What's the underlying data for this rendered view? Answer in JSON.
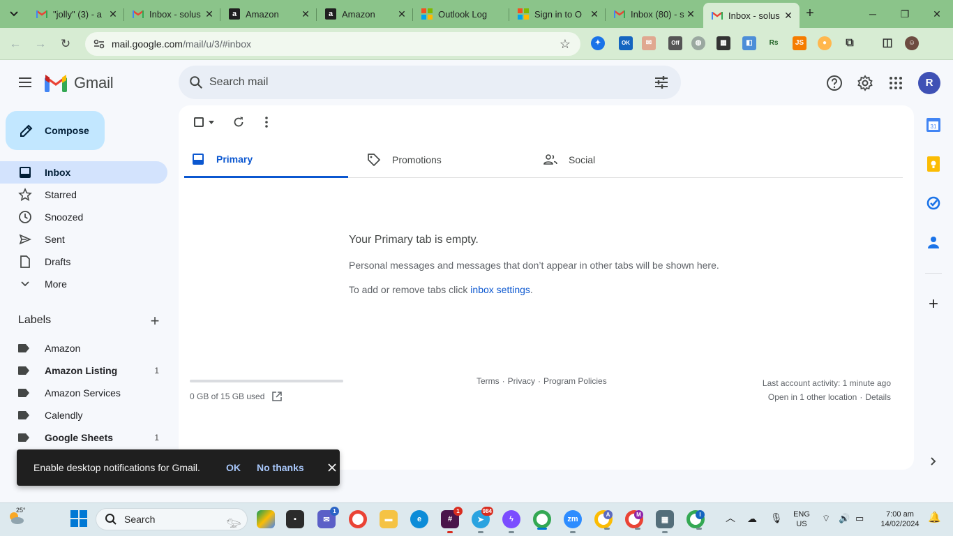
{
  "browser": {
    "tabs": [
      {
        "label": "\"jolly\" (3) - a",
        "favicon": "gmail-icon"
      },
      {
        "label": "Inbox - solus",
        "favicon": "gmail-icon"
      },
      {
        "label": "Amazon",
        "favicon": "amazon-icon"
      },
      {
        "label": "Amazon",
        "favicon": "amazon-icon"
      },
      {
        "label": "Outlook Log",
        "favicon": "microsoft-icon"
      },
      {
        "label": "Sign in to O",
        "favicon": "microsoft-icon"
      },
      {
        "label": "Inbox (80) - s",
        "favicon": "gmail-icon"
      },
      {
        "label": "Inbox - solus",
        "favicon": "gmail-icon"
      }
    ],
    "url_host": "mail.google.com",
    "url_path": "/mail/u/3/#inbox",
    "extension_badge_ok": "OK",
    "extension_badge_off": "Off"
  },
  "gmail": {
    "wordmark": "Gmail",
    "search_placeholder": "Search mail",
    "avatar_letter": "R",
    "compose_label": "Compose",
    "nav": [
      {
        "label": "Inbox",
        "icon": "inbox-icon"
      },
      {
        "label": "Starred",
        "icon": "star-icon"
      },
      {
        "label": "Snoozed",
        "icon": "clock-icon"
      },
      {
        "label": "Sent",
        "icon": "send-icon"
      },
      {
        "label": "Drafts",
        "icon": "draft-icon"
      },
      {
        "label": "More",
        "icon": "chevron-down-icon"
      }
    ],
    "labels_title": "Labels",
    "labels": [
      {
        "label": "Amazon",
        "count": ""
      },
      {
        "label": "Amazon Listing",
        "count": "1"
      },
      {
        "label": "Amazon Services",
        "count": ""
      },
      {
        "label": "Calendly",
        "count": ""
      },
      {
        "label": "Google Sheets",
        "count": "1"
      }
    ],
    "tabs": [
      {
        "label": "Primary",
        "icon": "inbox-icon"
      },
      {
        "label": "Promotions",
        "icon": "tag-icon"
      },
      {
        "label": "Social",
        "icon": "people-icon"
      }
    ],
    "empty": {
      "title": "Your Primary tab is empty.",
      "description": "Personal messages and messages that don’t appear in other tabs will be shown here.",
      "hint_prefix": "To add or remove tabs click ",
      "hint_link": "inbox settings",
      "hint_suffix": "."
    },
    "storage": {
      "text": "0 GB of 15 GB used",
      "used_fraction": 0
    },
    "footer": {
      "terms": "Terms",
      "sep": "·",
      "privacy": "Privacy",
      "policies": "Program Policies"
    },
    "activity": {
      "line1": "Last account activity: 1 minute ago",
      "line2_prefix": "Open in 1 other location",
      "line2_link": "Details"
    },
    "side_calendar_day": "31"
  },
  "snackbar": {
    "message": "Enable desktop notifications for Gmail.",
    "ok": "OK",
    "no_thanks": "No thanks"
  },
  "taskbar": {
    "weather_temp": "25°",
    "search_label": "Search",
    "badges": {
      "teams": "1",
      "slack": "1",
      "telegram": "984",
      "chrome_a": "A",
      "chrome_m": "M",
      "chrome_i": "I"
    },
    "zoom_label": "zm",
    "lang_line1": "ENG",
    "lang_line2": "US",
    "time": "7:00 am",
    "date": "14/02/2024"
  },
  "colors": {
    "tabstrip": "#8bc48a",
    "accent": "#0b57d0",
    "compose": "#c2e7ff",
    "nav_active": "#d3e3fd"
  }
}
